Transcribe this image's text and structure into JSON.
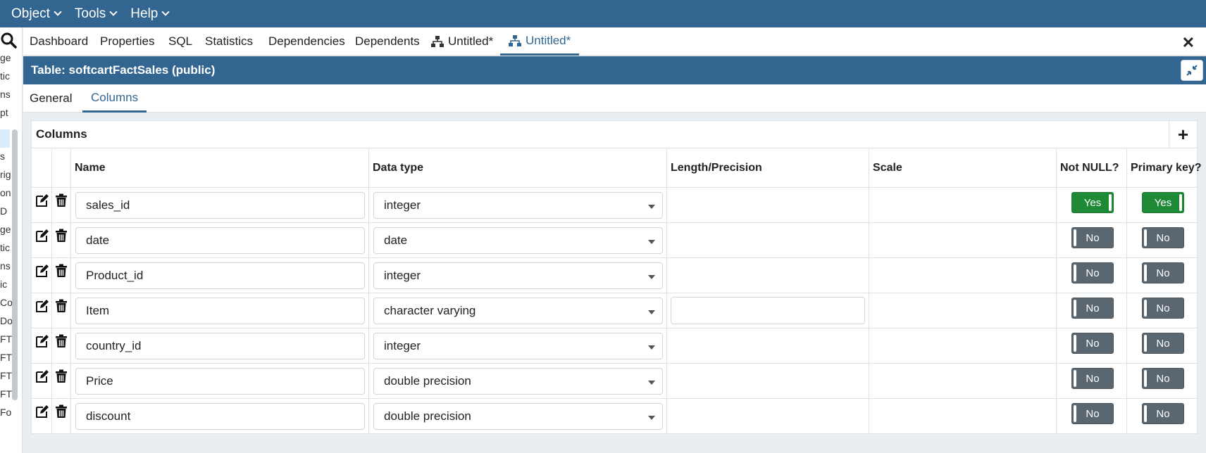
{
  "menubar": {
    "items": [
      "Object",
      "Tools",
      "Help"
    ]
  },
  "left_tree": {
    "fragments": [
      "ge",
      "tic",
      "ns",
      "pt",
      "",
      "s",
      "rig",
      "on",
      "D",
      "ge",
      "tic",
      "ns",
      "ic",
      "Co",
      "Do",
      "FT",
      "FT",
      "FT",
      "FT",
      "Fo"
    ]
  },
  "tabs": [
    {
      "label": "Dashboard"
    },
    {
      "label": "Properties"
    },
    {
      "label": "SQL"
    },
    {
      "label": "Statistics"
    },
    {
      "label": "Dependencies"
    },
    {
      "label": "Dependents"
    },
    {
      "label": "Untitled*",
      "icon": "hierarchy-icon"
    },
    {
      "label": "Untitled*",
      "icon": "hierarchy-icon",
      "active": true
    }
  ],
  "close_label": "✕",
  "dialog": {
    "title": "Table: softcartFactSales (public)"
  },
  "subtabs": [
    {
      "label": "General"
    },
    {
      "label": "Columns",
      "active": true
    }
  ],
  "columns_grid": {
    "title": "Columns",
    "add_label": "+",
    "headers": {
      "name": "Name",
      "data_type": "Data type",
      "length": "Length/Precision",
      "scale": "Scale",
      "not_null": "Not NULL?",
      "primary_key": "Primary key?"
    },
    "rows": [
      {
        "name": "sales_id",
        "data_type": "integer",
        "not_null": "Yes",
        "primary_key": "Yes",
        "length_editable": false
      },
      {
        "name": "date",
        "data_type": "date",
        "not_null": "No",
        "primary_key": "No",
        "length_editable": false
      },
      {
        "name": "Product_id",
        "data_type": "integer",
        "not_null": "No",
        "primary_key": "No",
        "length_editable": false
      },
      {
        "name": "Item",
        "data_type": "character varying",
        "not_null": "No",
        "primary_key": "No",
        "length_editable": true
      },
      {
        "name": "country_id",
        "data_type": "integer",
        "not_null": "No",
        "primary_key": "No",
        "length_editable": false
      },
      {
        "name": "Price",
        "data_type": "double precision",
        "not_null": "No",
        "primary_key": "No",
        "length_editable": false
      },
      {
        "name": "discount",
        "data_type": "double precision",
        "not_null": "No",
        "primary_key": "No",
        "length_editable": false
      }
    ]
  },
  "colors": {
    "brand": "#326690",
    "yes": "#1f8a36",
    "no": "#5b6770"
  }
}
